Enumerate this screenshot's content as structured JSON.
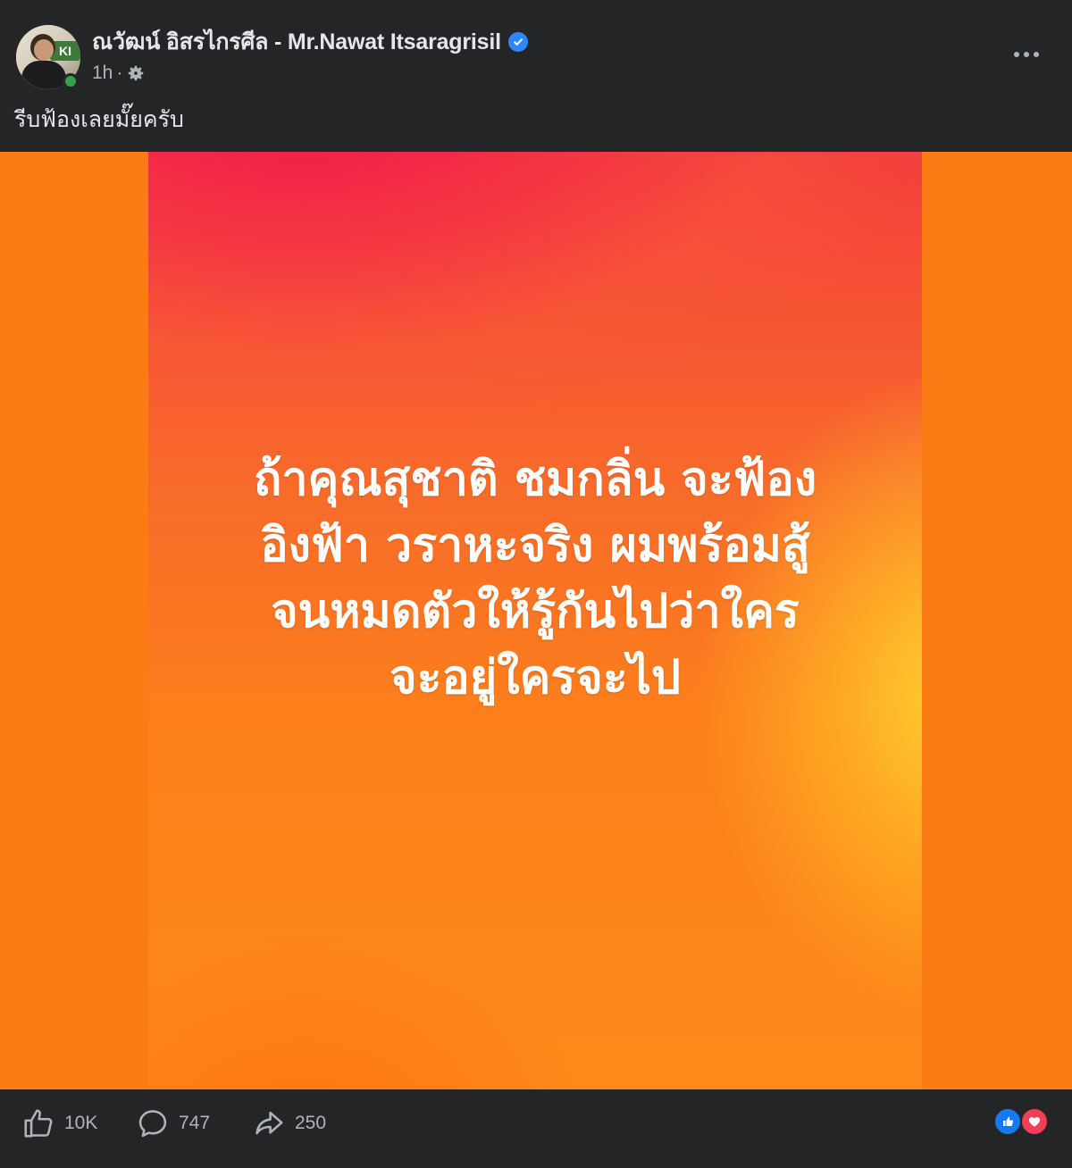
{
  "post": {
    "author_name": "ณวัฒน์ อิสรไกรศีล - Mr.Nawat Itsaragrisil",
    "time": "1h",
    "separator": "·",
    "caption": "รีบฟ้องเลยมั๊ยครับ",
    "avatar_sign_text": "KI",
    "image_text_lines": [
      "ถ้าคุณสุชาติ ชมกลิ่น จะฟ้อง",
      "อิงฟ้า วราหะจริง ผมพร้อมสู้",
      "จนหมดตัวให้รู้กันไปว่าใคร",
      "จะอยู่ใครจะไป"
    ]
  },
  "footer": {
    "likes": "10K",
    "comments": "747",
    "shares": "250"
  },
  "icons": {
    "verified": "verified-badge-icon",
    "audience": "gear-icon",
    "more": "more-dots-icon",
    "like": "thumbs-up-icon",
    "comment": "comment-bubble-icon",
    "share": "share-arrow-icon",
    "reaction_like": "like-reaction-icon",
    "reaction_love": "love-reaction-icon"
  },
  "colors": {
    "background": "#242526",
    "text_primary": "#e4e6eb",
    "text_secondary": "#b0b3b8",
    "verified_blue": "#2d88ff",
    "online_green": "#31a24c",
    "media_orange": "#fb7c15",
    "like_blue": "#1877f2",
    "love_red": "#f33e58"
  }
}
